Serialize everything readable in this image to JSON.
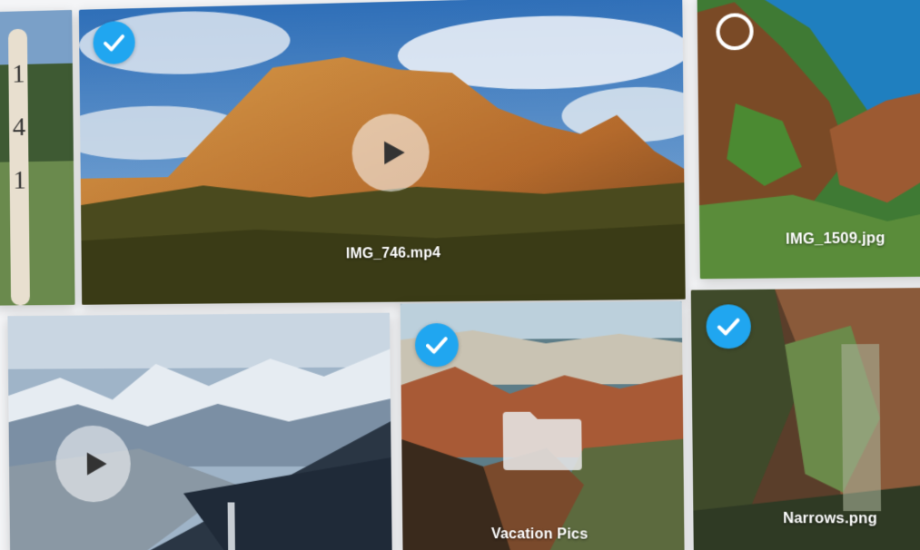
{
  "gallery": {
    "items": [
      {
        "id": "edge-left",
        "label": "",
        "selected": null,
        "kind": "photo"
      },
      {
        "id": "img746",
        "label": "IMG_746.mp4",
        "selected": true,
        "kind": "video"
      },
      {
        "id": "img1509",
        "label": "IMG_1509.jpg",
        "selected": false,
        "kind": "photo"
      },
      {
        "id": "mountains",
        "label": "",
        "selected": null,
        "kind": "video"
      },
      {
        "id": "vacation",
        "label": "Vacation Pics",
        "selected": true,
        "kind": "folder"
      },
      {
        "id": "narrows",
        "label": "Narrows.png",
        "selected": true,
        "kind": "photo"
      }
    ]
  },
  "colors": {
    "accent": "#20a6f0",
    "background": "#f4f5f7"
  },
  "icons": {
    "selected": "checkmark-icon",
    "unselected": "empty-circle-icon",
    "video": "play-icon",
    "folder": "folder-icon"
  }
}
